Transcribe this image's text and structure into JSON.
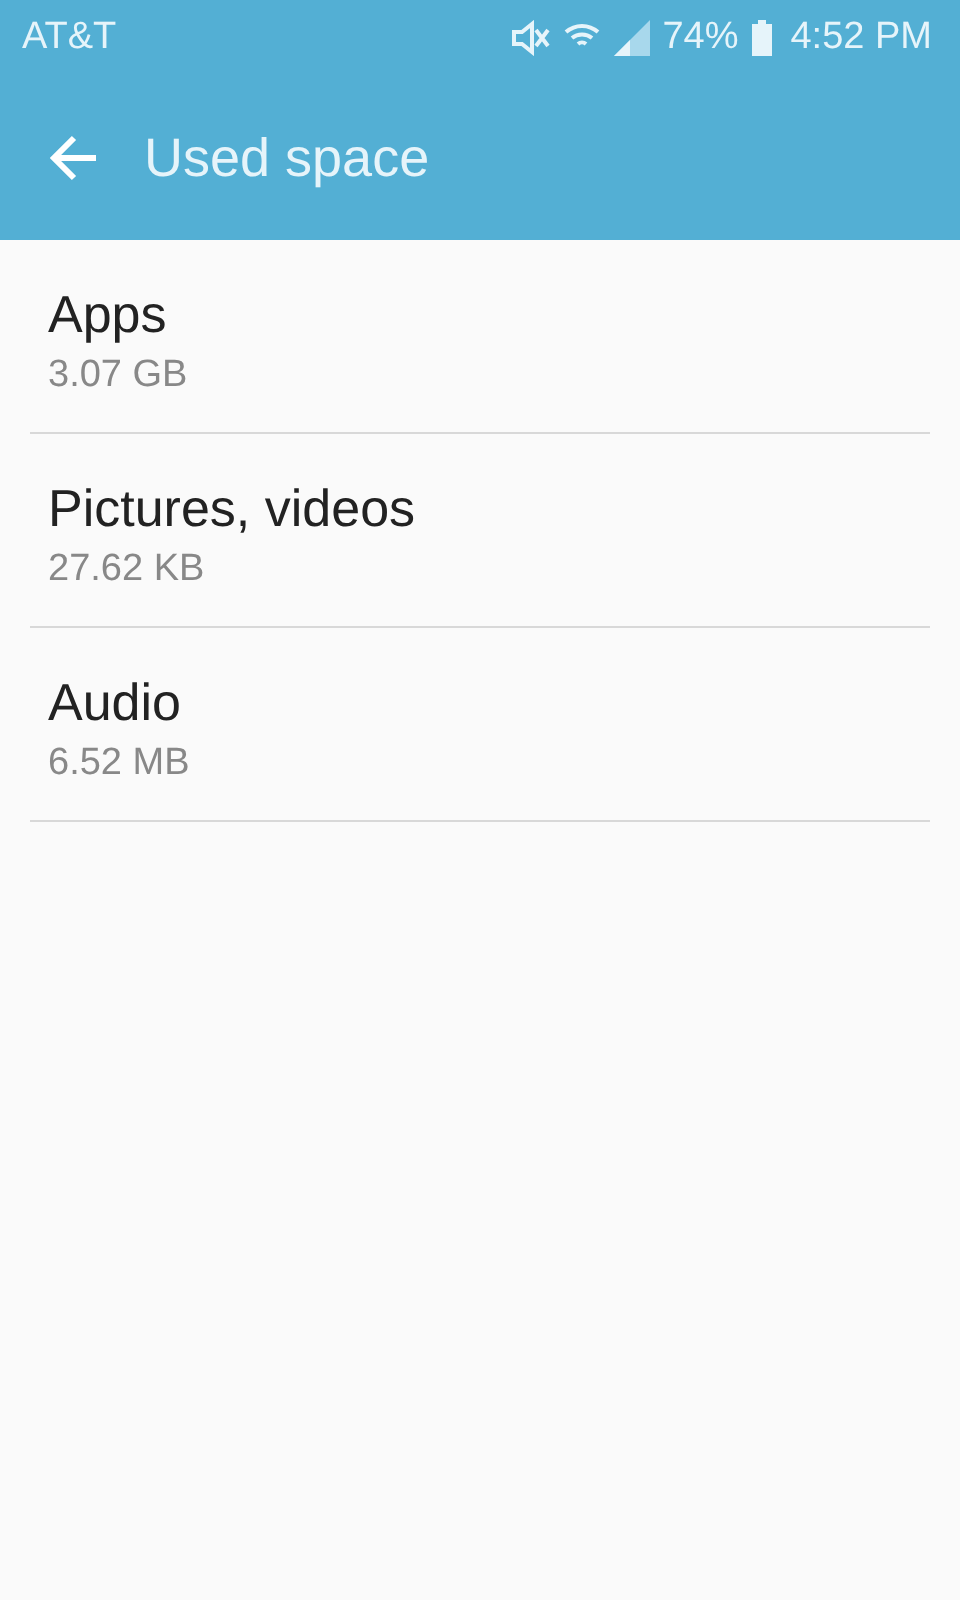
{
  "status_bar": {
    "carrier": "AT&T",
    "battery": "74%",
    "time": "4:52 PM"
  },
  "app_bar": {
    "title": "Used space"
  },
  "items": [
    {
      "title": "Apps",
      "size": "3.07 GB"
    },
    {
      "title": "Pictures, videos",
      "size": "27.62 KB"
    },
    {
      "title": "Audio",
      "size": "6.52 MB"
    }
  ]
}
